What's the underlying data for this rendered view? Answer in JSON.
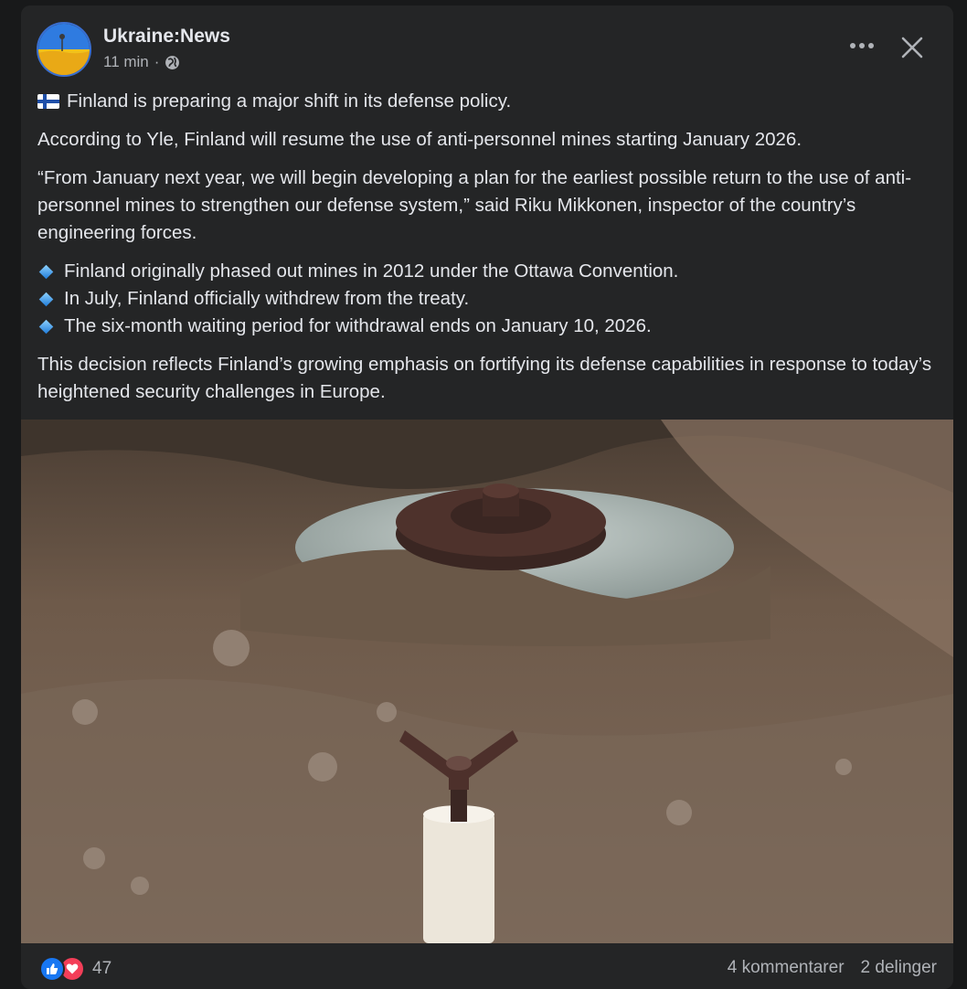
{
  "post": {
    "page_name": "Ukraine:News",
    "time": "11 min",
    "audience_icon": "globe-icon",
    "paragraphs": {
      "lead": "Finland is preparing a major shift in its defense policy.",
      "p1": "According to Yle, Finland will resume the use of anti-personnel mines starting January 2026.",
      "p2": "“From January next year, we will begin developing a plan for the earliest possible return to the use of anti-personnel mines to strengthen our defense system,” said Riku Mikkonen, inspector of the country’s engineering forces.",
      "bullets": [
        "Finland originally phased out mines in 2012 under the Ottawa Convention.",
        "In July, Finland officially withdrew from the treaty.",
        "The six-month waiting period for withdrawal ends on January 10, 2026."
      ],
      "p3": "This decision reflects Finland’s growing emphasis on fortifying its defense capabilities in response to today’s heightened security challenges in Europe."
    },
    "reactions": {
      "count": "47",
      "types": [
        "like-icon",
        "love-icon"
      ]
    },
    "comments": "4 kommentarer",
    "shares": "2 delinger"
  },
  "colors": {
    "card_bg": "#242526",
    "page_bg": "#18191a",
    "text_primary": "#e4e6eb",
    "text_secondary": "#b0b3b8",
    "like_blue": "#1877f2",
    "love_red": "#f33e58"
  }
}
